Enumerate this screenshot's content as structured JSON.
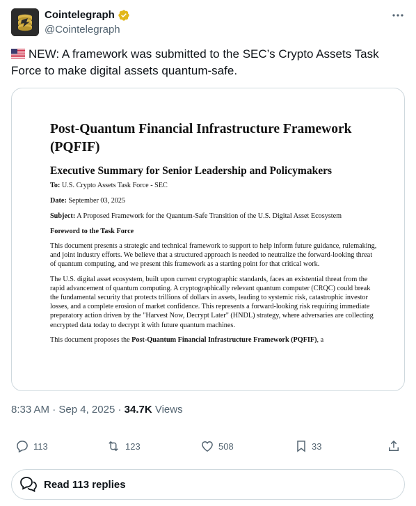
{
  "author": {
    "display_name": "Cointelegraph",
    "handle": "@Cointelegraph",
    "verified_badge_color": "#e2b719",
    "avatar_icon": "cointelegraph-logo"
  },
  "post": {
    "flag_icon": "us-flag",
    "text": "NEW: A framework was submitted to the SEC’s Crypto Assets Task Force to make digital assets quantum-safe."
  },
  "document": {
    "title": "Post-Quantum Financial Infrastructure Framework (PQFIF)",
    "subtitle": "Executive Summary for Senior Leadership and Policymakers",
    "to_label": "To:",
    "to_value": "U.S. Crypto Assets Task Force - SEC",
    "date_label": "Date:",
    "date_value": "September 03, 2025",
    "subject_label": "Subject:",
    "subject_value": "A Proposed Framework for the Quantum-Safe Transition of the U.S. Digital Asset Ecosystem",
    "foreword_heading": "Foreword to the Task Force",
    "paragraph1": "This document presents a strategic and technical framework to support to help inform future guidance, rulemaking, and joint industry efforts. We believe that a structured approach is needed to neutralize the forward-looking threat of quantum computing, and we present this framework as a starting point for that critical work.",
    "paragraph2": "The U.S. digital asset ecosystem, built upon current cryptographic standards, faces an existential threat from the rapid advancement of quantum computing. A cryptographically relevant quantum computer (CRQC) could break the fundamental security that protects trillions of dollars in assets, leading to systemic risk, catastrophic investor losses, and a complete erosion of market confidence. This represents a forward-looking risk requiring immediate preparatory action driven by the \"Harvest Now, Decrypt Later\" (HNDL) strategy, where adversaries are collecting encrypted data today to decrypt it with future quantum machines.",
    "paragraph3_start": "This document proposes the",
    "paragraph3_bold": "Post-Quantum Financial Infrastructure Framework (PQFIF)",
    "paragraph3_end": ", a"
  },
  "meta": {
    "time": "8:33 AM",
    "separator": "·",
    "date": "Sep 4, 2025",
    "views_count": "34.7K",
    "views_label": "Views"
  },
  "actions": {
    "replies": "113",
    "reposts": "123",
    "likes": "508",
    "bookmarks": "33"
  },
  "read_replies_label": "Read 113 replies",
  "colors": {
    "text_primary": "#0f1419",
    "text_secondary": "#536471",
    "border": "#cfd9de"
  }
}
